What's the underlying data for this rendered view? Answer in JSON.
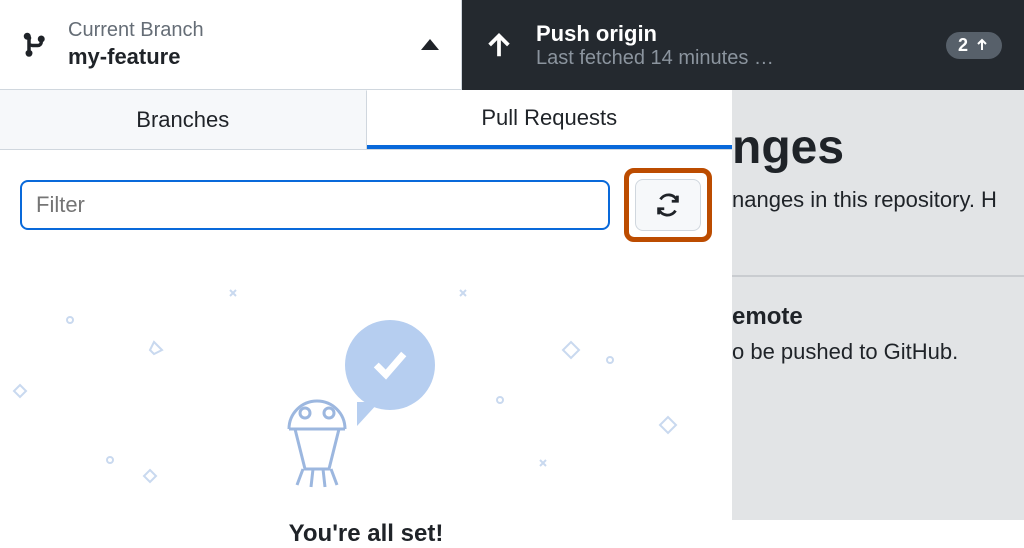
{
  "toolbar": {
    "branch_label": "Current Branch",
    "branch_name": "my-feature",
    "push_title": "Push origin",
    "push_subtitle": "Last fetched 14 minutes …",
    "push_badge_count": "2"
  },
  "tabs": {
    "branches": "Branches",
    "pull_requests": "Pull Requests"
  },
  "filter": {
    "placeholder": "Filter"
  },
  "empty": {
    "title": "You're all set!"
  },
  "rightpane": {
    "heading": "nges",
    "sub": "nanges in this repository. H",
    "section_title": "emote",
    "section_text": "o be pushed to GitHub."
  }
}
